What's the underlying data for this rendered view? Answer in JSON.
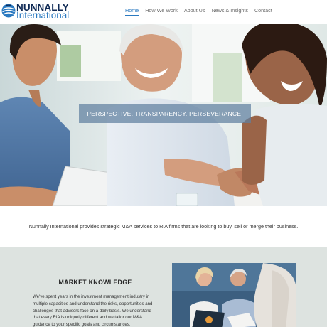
{
  "brand": {
    "name_top": "NUNNALLY",
    "name_bottom": "International",
    "colors": {
      "navy": "#0f2a55",
      "blue": "#2a79c0"
    }
  },
  "nav": {
    "items": [
      {
        "label": "Home",
        "active": true
      },
      {
        "label": "How We Work",
        "active": false
      },
      {
        "label": "About Us",
        "active": false
      },
      {
        "label": "News & Insights",
        "active": false
      },
      {
        "label": "Contact",
        "active": false
      }
    ]
  },
  "hero": {
    "tagline": "PERSPECTIVE. TRANSPARENCY. PERSEVERANCE.",
    "image": "business-meeting-handshake-photo"
  },
  "intro": {
    "text": "Nunnally International provides strategic M&A services to RIA firms that are looking to buy, sell or merge their business."
  },
  "feature": {
    "title": "MARKET KNOWLEDGE",
    "body": "We've spent years in the investment management industry in multiple capacities and understand the risks, opportunities and challenges that advisors face on a daily basis. We understand that every RIA is uniquely different and we tailor our M&A guidance to your specific goals and circumstances.",
    "image": "advisors-meeting-photo"
  }
}
